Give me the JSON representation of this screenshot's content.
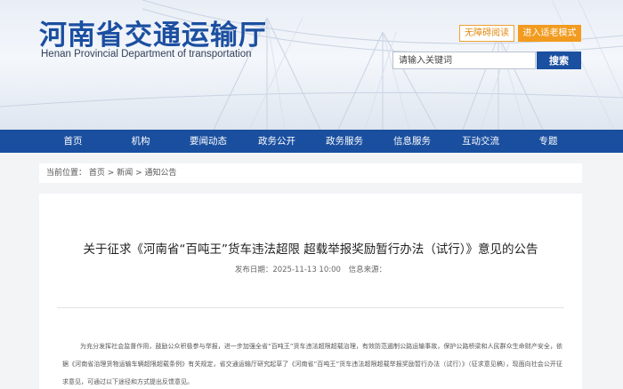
{
  "header": {
    "title": "河南省交通运输厅",
    "subtitle": "Henan Provincial Department of transportation",
    "accessible_label": "无障碍阅读",
    "elder_label": "进入适老模式",
    "search_placeholder": "请输入关键词",
    "search_button": "搜索"
  },
  "nav": {
    "items": [
      "首页",
      "机构",
      "要闻动态",
      "政务公开",
      "政务服务",
      "信息服务",
      "互动交流",
      "专题"
    ]
  },
  "breadcrumb": {
    "prefix": "当前位置：",
    "items": [
      "首页",
      "新闻",
      "通知公告"
    ],
    "separator": ">"
  },
  "article": {
    "title": "关于征求《河南省“百吨王”货车违法超限 超载举报奖励暂行办法（试行）》意见的公告",
    "meta_publish": "发布日期：2025-11-13 10:00",
    "meta_source": "信息来源：",
    "body": "为充分发挥社会监督作用，鼓励公众积极参与举报，进一步加强全省“百吨王”货车违法超限超载治理，有效防范遏制公路运输事故，保护公路桥梁和人民群众生命财产安全，依据《河南省治理货物运输车辆超限超载条例》有关规定，省交通运输厅研究起草了《河南省“百吨王”货车违法超限超载举报奖励暂行办法（试行）》（征求意见稿），现面向社会公开征求意见，可通过以下途径和方式提出反馈意见。"
  }
}
